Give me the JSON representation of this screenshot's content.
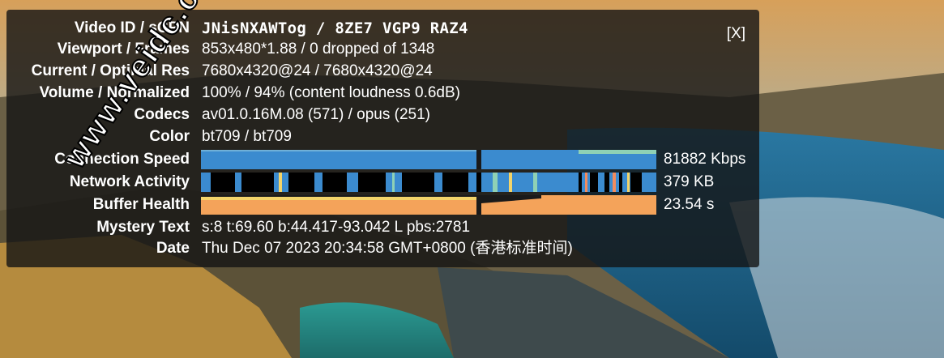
{
  "panel": {
    "close_label": "[X]",
    "rows": {
      "video_id": {
        "label": "Video ID / sCPN",
        "value": "JNisNXAWTog / 8ZE7 VGP9 RAZ4"
      },
      "viewport": {
        "label": "Viewport / Frames",
        "value": "853x480*1.88 / 0 dropped of 1348"
      },
      "resolution": {
        "label": "Current / Optimal Res",
        "value": "7680x4320@24 / 7680x4320@24"
      },
      "volume": {
        "label": "Volume / Normalized",
        "value": "100% / 94% (content loudness 0.6dB)"
      },
      "codecs": {
        "label": "Codecs",
        "value": "av01.0.16M.08 (571) / opus (251)"
      },
      "color": {
        "label": "Color",
        "value": "bt709 / bt709"
      },
      "connection_speed": {
        "label": "Connection Speed",
        "value": "81882 Kbps"
      },
      "network_activity": {
        "label": "Network Activity",
        "value": "379 KB"
      },
      "buffer_health": {
        "label": "Buffer Health",
        "value": "23.54 s"
      },
      "mystery_text": {
        "label": "Mystery Text",
        "value": "s:8 t:69.60 b:44.417-93.042 L pbs:2781"
      },
      "date": {
        "label": "Date",
        "value": "Thu Dec 07 2023 20:34:58 GMT+0800 (香港标准时间)"
      }
    }
  },
  "watermark": "www.veidc.com",
  "colors": {
    "panel_bg": "#141414",
    "connection_graph": "#3b8bcf",
    "network_graph": "#3b8bcf",
    "buffer_graph": "#f4a35a"
  }
}
